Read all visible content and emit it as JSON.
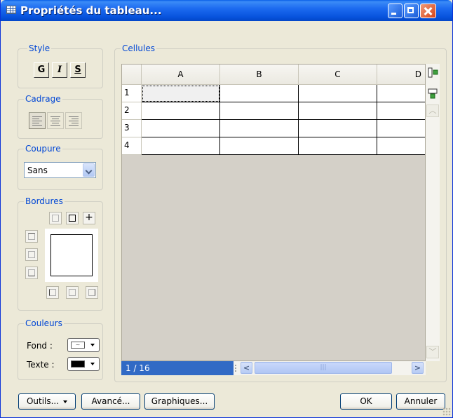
{
  "window": {
    "title": "Propriétés du tableau..."
  },
  "style_group": {
    "label": "Style",
    "bold_label": "G",
    "italic_label": "I",
    "strike_label": "S"
  },
  "cadrage_group": {
    "label": "Cadrage",
    "selected": "left"
  },
  "coupure_group": {
    "label": "Coupure",
    "value": "Sans"
  },
  "bordures_group": {
    "label": "Bordures"
  },
  "couleurs_group": {
    "label": "Couleurs",
    "fond_label": "Fond :",
    "texte_label": "Texte :",
    "texte_color": "#000000"
  },
  "cellules": {
    "label": "Cellules",
    "columns": [
      "A",
      "B",
      "C",
      "D"
    ],
    "rows": [
      "1",
      "2",
      "3",
      "4"
    ],
    "counter": "1 / 16"
  },
  "buttons": {
    "outils": "Outils...",
    "avance": "Avancé...",
    "graphiques": "Graphiques...",
    "ok": "OK",
    "annuler": "Annuler"
  },
  "colors": {
    "title_blue": "#0A5FE8",
    "legend_blue": "#0046D5",
    "dialog_bg": "#ECE9D8",
    "selection_blue": "#316AC5"
  }
}
